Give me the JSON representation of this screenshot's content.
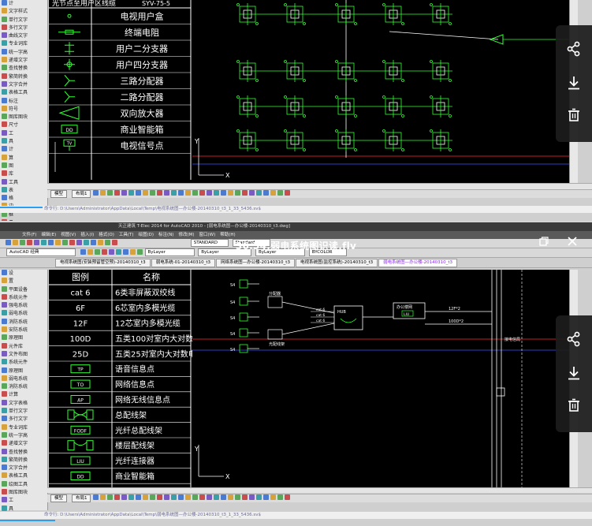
{
  "top": {
    "palette": [
      "计",
      "文字样式",
      "单行文字",
      "多行文字",
      "曲线文字",
      "专业词库",
      "统一字高",
      "递增文字",
      "查找替换",
      "繁简转换",
      "文字合并",
      "表格工具",
      "标注",
      "符号",
      "图库图块",
      "尺寸",
      "工",
      "具",
      "计",
      "算",
      "图",
      "库",
      "工具",
      "表",
      "格",
      "边",
      "框",
      "具"
    ],
    "legend": {
      "cut_row": "光节点至用户区线缆",
      "cut_code": "SYV-75-5",
      "rows": [
        {
          "icon": "ellipse",
          "text": "电视用户盒"
        },
        {
          "icon": "resistor",
          "text": "终端电阻"
        },
        {
          "icon": "split2",
          "text": "用户二分支器"
        },
        {
          "icon": "split4",
          "text": "用户四分支器"
        },
        {
          "icon": "dist2",
          "text": "三路分配器"
        },
        {
          "icon": "dist2b",
          "text": "二路分配器"
        },
        {
          "icon": "amp",
          "text": "双向放大器"
        },
        {
          "icon": "box",
          "label": "DD",
          "text": "商业智能箱"
        },
        {
          "icon": "point",
          "label": "TV",
          "text": "电视信号点"
        }
      ]
    },
    "canvas": {
      "axis_y": "Y",
      "axis_x": "X"
    },
    "status": {
      "model_tab": "模型",
      "layout_tab": "布局1"
    },
    "cmdline": "命令行: D:\\Users\\Administrator\\AppData\\Local\\Temp\\电视系统图—办公楼-20140310_t3_1_33_5436.sv$"
  },
  "bottom": {
    "video_title": "36.54.弱电系统图识读.flv",
    "menu": [
      "文件(F)",
      "编辑(E)",
      "视图(V)",
      "插入(I)",
      "格式(O)",
      "工具(T)",
      "绘图(D)",
      "标注(N)",
      "修改(M)",
      "窗口(W)",
      "帮助(H)"
    ],
    "app_title": "天正建筑 T-Elec 2014 for AutoCAD 2010 - [弱电系统图—办公楼-20140310_t3.dwg]",
    "workspace": "AutoCAD 经典",
    "text_style": "STANDARD",
    "dim_style": "Standard",
    "layer_combo": "ByLayer",
    "linetype_combo": "ByLayer",
    "lineweight_combo": "ByLayer",
    "color_combo": "BYCOLOR",
    "doc_tabs": [
      "电视系统图(安装预留管空预)-20140310_t3",
      "弱电系统-01-20140310_t3",
      "网络系统图—办公楼-20140310_t3",
      "电视系统图(监控系统)-20140310_t3",
      "弱电系统图—办公楼-20140310_t3"
    ],
    "palette": [
      "设",
      "置",
      "平面设备",
      "系统元件",
      "强电系统",
      "弱电系统",
      "消防系统",
      "安防系统",
      "原理图",
      "元件库",
      "文件布图",
      "系统元件",
      "原理图",
      "弱电系统",
      "消防系统",
      "计算",
      "文字表格",
      "单行文字",
      "多行文字",
      "专业词库",
      "统一字高",
      "递增文字",
      "查找替换",
      "繁简转换",
      "文字合并",
      "表格工具",
      "绘图工具",
      "图库图块",
      "工",
      "具",
      "计"
    ],
    "legend": {
      "header_icon": "图例",
      "header_name": "名称",
      "rows": [
        {
          "icon": "cat 6",
          "text": "6类非屏蔽双绞线"
        },
        {
          "icon": "6F",
          "text": "6芯室内多模光缆"
        },
        {
          "icon": "12F",
          "text": "12芯室内多模光缆"
        },
        {
          "icon": "100D",
          "text": "五类100对室内大对数电缆"
        },
        {
          "icon": "25D",
          "text": "五类25对室内大对数电缆"
        },
        {
          "icon": "TP",
          "box": true,
          "text": "语音信息点"
        },
        {
          "icon": "TO",
          "box": true,
          "text": "网络信息点"
        },
        {
          "icon": "AP",
          "box": true,
          "text": "网络无线信息点"
        },
        {
          "icon": "",
          "rack": true,
          "text": "总配线架"
        },
        {
          "icon": "FODF",
          "box": true,
          "text": "光纤总配线架"
        },
        {
          "icon": "",
          "rack2": true,
          "text": "楼层配线架"
        },
        {
          "icon": "LIU",
          "box": true,
          "text": "光纤连接器"
        },
        {
          "icon": "DD",
          "box": true,
          "text": "商业智能箱"
        }
      ]
    },
    "canvas": {
      "left_group": [
        "S4",
        "S4",
        "S4",
        "S4",
        "S4"
      ],
      "left_group_labels": [
        "分配器",
        "光配线架"
      ],
      "cat_labels": [
        "cat 6",
        "cat 6",
        "cat 6"
      ],
      "mid_box": "HUB",
      "right_box_title": "办公楼网",
      "right_box_inner": "LIU",
      "link_labels": [
        "12F*2",
        "100D*2"
      ],
      "vertical_label": "接电信局",
      "axis_y": "Y",
      "axis_x": "X"
    },
    "status": {
      "model_tab": "模型",
      "layout_tab": "布局1"
    },
    "cmdline": "命令行: D:\\Users\\Administrator\\AppData\\Local\\Temp\\弱电系统图—办公楼-20140310_t3_1_33_5436.sv$"
  },
  "colors": {
    "canvas_bg": "#000000",
    "cad_green": "#33ff33",
    "cad_white": "#ffffff",
    "cad_red": "#ff2a2a",
    "accent_blue": "#2a9df4",
    "legend_text": "#ffffff"
  },
  "icons": [
    "share-icon",
    "download-icon",
    "trash-icon",
    "minimize-icon",
    "close-icon"
  ]
}
